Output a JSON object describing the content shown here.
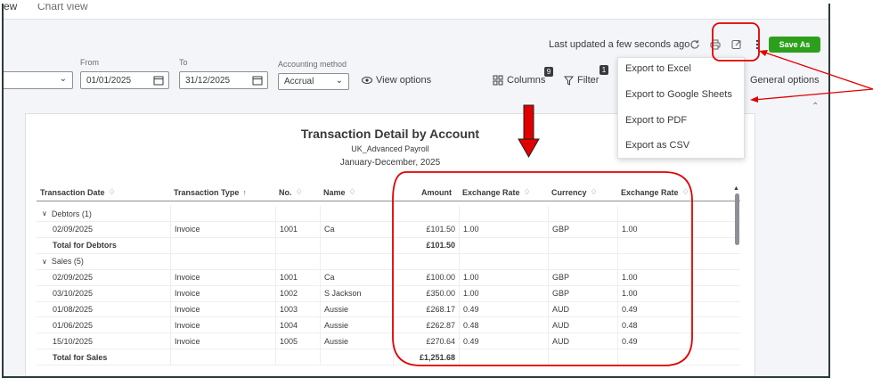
{
  "tabs": [
    "ew",
    "Chart view"
  ],
  "toolbar": {
    "last_updated": "Last updated a few seconds ago",
    "save_as": "Save As",
    "from_label": "From",
    "to_label": "To",
    "from_value": "01/01/2025",
    "to_value": "31/12/2025",
    "accounting_method_label": "Accounting method",
    "accounting_method_value": "Accrual",
    "view_options": "View options",
    "columns": "Columns",
    "columns_count": "9",
    "filter": "Filter",
    "filter_count": "1",
    "general_options": "General options"
  },
  "export_menu": {
    "items": [
      "Export to Excel",
      "Export to Google Sheets",
      "Export to PDF",
      "Export as CSV"
    ]
  },
  "report": {
    "title": "Transaction Detail by Account",
    "company": "UK_Advanced Payroll",
    "period": "January-December, 2025",
    "columns": [
      "Transaction Date",
      "Transaction Type",
      "No.",
      "Name",
      "Amount",
      "Exchange Rate",
      "Currency",
      "Exchange Rate"
    ],
    "sort_indicators": [
      "♢",
      "↑",
      "♢",
      "♢",
      "",
      "♢",
      "♢",
      "♢"
    ],
    "rows": [
      {
        "kind": "group",
        "cells": [
          "Debtors (1)",
          "",
          "",
          "",
          "",
          "",
          "",
          ""
        ]
      },
      {
        "kind": "data",
        "cells": [
          "02/09/2025",
          "Invoice",
          "1001",
          "Ca",
          "£101.50",
          "1.00",
          "GBP",
          "1.00"
        ]
      },
      {
        "kind": "total",
        "cells": [
          "Total for Debtors",
          "",
          "",
          "",
          "£101.50",
          "",
          "",
          ""
        ]
      },
      {
        "kind": "group",
        "cells": [
          "Sales (5)",
          "",
          "",
          "",
          "",
          "",
          "",
          ""
        ]
      },
      {
        "kind": "data",
        "cells": [
          "02/09/2025",
          "Invoice",
          "1001",
          "Ca",
          "£100.00",
          "1.00",
          "GBP",
          "1.00"
        ]
      },
      {
        "kind": "data",
        "cells": [
          "03/10/2025",
          "Invoice",
          "1002",
          "S Jackson",
          "£350.00",
          "1.00",
          "GBP",
          "1.00"
        ]
      },
      {
        "kind": "data",
        "cells": [
          "01/08/2025",
          "Invoice",
          "1003",
          "Aussie",
          "£268.17",
          "0.49",
          "AUD",
          "0.49"
        ]
      },
      {
        "kind": "data",
        "cells": [
          "01/06/2025",
          "Invoice",
          "1004",
          "Aussie",
          "£262.87",
          "0.48",
          "AUD",
          "0.48"
        ]
      },
      {
        "kind": "data",
        "cells": [
          "15/10/2025",
          "Invoice",
          "1005",
          "Aussie",
          "£270.64",
          "0.49",
          "AUD",
          "0.49"
        ]
      },
      {
        "kind": "total",
        "cells": [
          "Total for Sales",
          "",
          "",
          "",
          "£1,251.68",
          "",
          "",
          ""
        ]
      }
    ]
  },
  "colors": {
    "save_button": "#2ca01c",
    "annotation": "#e00000"
  }
}
